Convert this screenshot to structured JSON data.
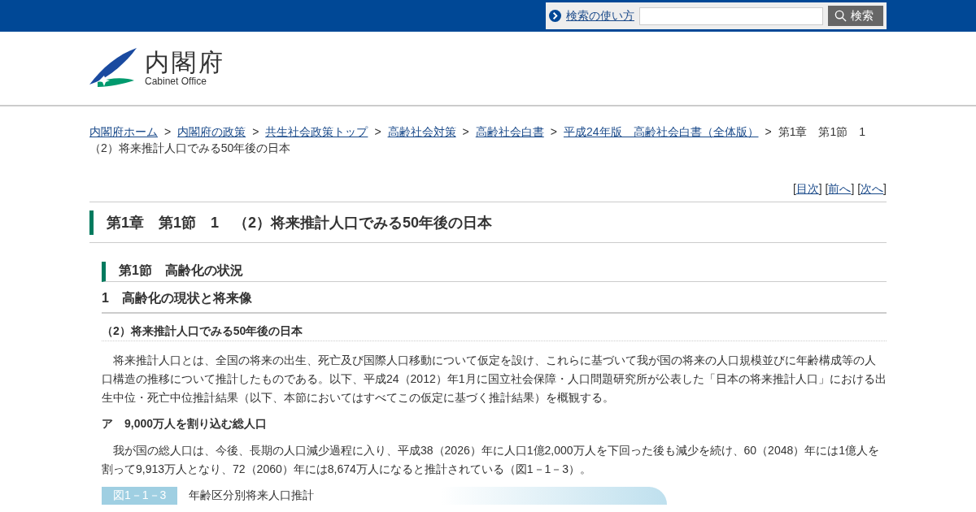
{
  "top_bar": {
    "help_link": "検索の使い方",
    "search_button": "検索"
  },
  "logo": {
    "title": "内閣府",
    "subtitle": "Cabinet Office"
  },
  "breadcrumb": {
    "separator": ">",
    "links": [
      "内閣府ホーム",
      "内閣府の政策",
      "共生社会政策トップ",
      "高齢社会対策",
      "高齢社会白書",
      "平成24年版　高齢社会白書（全体版）"
    ],
    "current": [
      "第1章　第1節　1",
      "（2）将来推計人口でみる50年後の日本"
    ]
  },
  "page_nav": {
    "brackets": [
      "[",
      "]"
    ],
    "links": [
      "目次",
      "前へ",
      "次へ"
    ]
  },
  "page_title": "第1章　第1節　1　（2）将来推計人口でみる50年後の日本",
  "section_title": "第1節　高齢化の状況",
  "subsection_title": "1　高齢化の現状と将来像",
  "item_title": "（2）将来推計人口でみる50年後の日本",
  "blocks": [
    {
      "kind": "paragraph",
      "text": "将来推計人口とは、全国の将来の出生、死亡及び国際人口移動について仮定を設け、これらに基づいて我が国の将来の人口規模並びに年齢構成等の人口構造の推移について推計したものである。以下、平成24（2012）年1月に国立社会保障・人口問題研究所が公表した「日本の将来推計人口」における出生中位・死亡中位推計結果（以下、本節においてはすべてこの仮定に基づく推計結果）を概観する。"
    },
    {
      "kind": "heading",
      "text": "ア　9,000万人を割り込む総人口"
    },
    {
      "kind": "paragraph",
      "text": "我が国の総人口は、今後、長期の人口減少過程に入り、平成38（2026）年に人口1億2,000万人を下回った後も減少を続け、60（2048）年には1億人を割って9,913万人となり、72（2060）年には8,674万人になると推計されている（図1－1－3）。"
    }
  ],
  "figure": {
    "number": "図1－1－3",
    "title": "年齢区分別将来人口推計"
  }
}
